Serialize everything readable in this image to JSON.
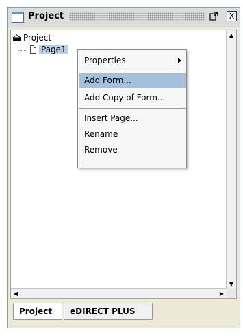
{
  "panel": {
    "title": "Project",
    "float_icon": "undock-icon",
    "close_icon": "close-icon",
    "close_glyph": "X"
  },
  "tree": {
    "root_label": "Project",
    "child_label": "Page1"
  },
  "context_menu": {
    "items": [
      {
        "label": "Properties",
        "has_submenu": true
      },
      {
        "label": "Add Form...",
        "highlighted": true
      },
      {
        "label": "Add Copy of Form..."
      },
      {
        "label": "Insert Page..."
      },
      {
        "label": "Rename"
      },
      {
        "label": "Remove"
      }
    ]
  },
  "tabs": [
    {
      "label": "Project",
      "active": true
    },
    {
      "label": "eDIRECT PLUS",
      "active": false
    }
  ],
  "colors": {
    "selection": "#b8cfe5",
    "menu_highlight": "#a7c0da",
    "panel_border": "#7f9db9"
  }
}
